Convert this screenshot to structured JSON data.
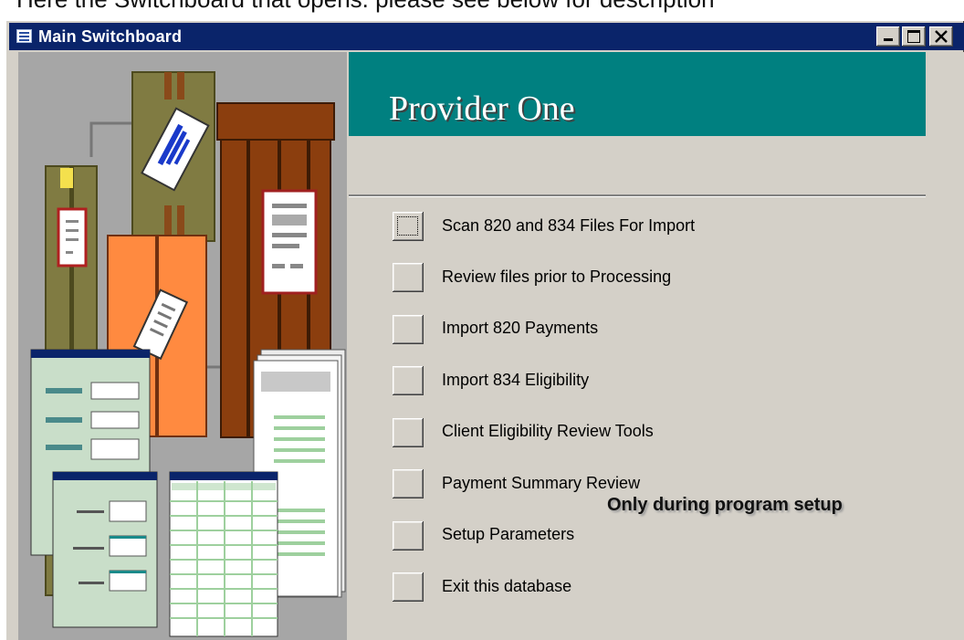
{
  "window": {
    "title": "Main Switchboard",
    "controls": [
      "minimize",
      "maximize",
      "close"
    ]
  },
  "top_cut_text": "Here the Switchboard that opens.  please see below  for description",
  "banner": {
    "title": "Provider One"
  },
  "menu": {
    "items": [
      {
        "label": "Scan 820 and 834 Files For Import"
      },
      {
        "label": "Review files prior to Processing"
      },
      {
        "label": "Import 820 Payments"
      },
      {
        "label": "Import 834 Eligibility"
      },
      {
        "label": "Client Eligibility Review Tools"
      },
      {
        "label": "Payment Summary Review"
      },
      {
        "label": "Setup Parameters"
      },
      {
        "label": "Exit this database"
      }
    ]
  },
  "note": "Only during program setup",
  "colors": {
    "titlebar": "#0a246a",
    "banner": "#008080",
    "face": "#d4d0c8"
  }
}
